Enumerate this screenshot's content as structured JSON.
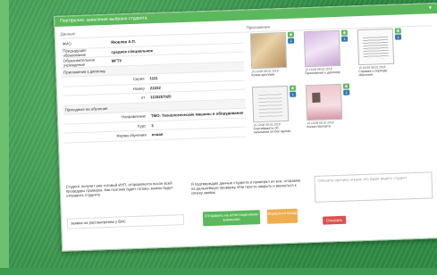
{
  "panel": {
    "title": "Портфолио: заявление выбранн студента"
  },
  "columns": {
    "data_label": "Данные",
    "attachments_label": "Приложения"
  },
  "form": {
    "fio": {
      "label": "ФИО",
      "value": "Яковлев А.П."
    },
    "prev_education": {
      "label": "Предыдущее образование",
      "value": "среднее специальное"
    },
    "institution": {
      "label": "Образовательное учреждение",
      "value": "МГТУ"
    },
    "diploma_section": "Приложения к диплому",
    "series": {
      "label": "Серия",
      "value": "1111"
    },
    "number": {
      "label": "Номер",
      "value": "22222"
    },
    "from": {
      "label": "от",
      "value": "1115257020"
    },
    "study_section": "Пригодные на обучение",
    "direction": {
      "label": "Направление",
      "value": "ТМО: Технологические машины и оборудование"
    },
    "course": {
      "label": "Курс",
      "value": "3"
    },
    "form_of_study": {
      "label": "Форма обучения",
      "value": "очная"
    }
  },
  "attachments": [
    {
      "meta": "15.19:08 08.02.2018",
      "caption": "Копия диплома"
    },
    {
      "meta": "15.19:08 08.02.2018",
      "caption": "Приложение к диплому"
    },
    {
      "meta": "15.19:08 08.02.2018",
      "caption": "Справка о периоде обучения"
    },
    {
      "meta": "15.19:08 08.02.2018",
      "caption": "Сертификаты об окончании on-line курсов"
    },
    {
      "meta": "15.19:08 08.02.2018",
      "caption": "Копия паспорта"
    }
  ],
  "icons": {
    "view": "eye-icon",
    "download": "download-icon"
  },
  "bottom": {
    "note_left": "Студент получит уже готовый ИУП, отправляется после всей процедуры проверок. Как поэтому будет готовы, можно будет отправить студенту",
    "status": "заявка на рассмотрении у ВАС",
    "note_mid": "Я подтверждаю данные студента и проверил их все, отправлю на дальнейшую проверку. Или просто закрыть и вернуться к списку заявок",
    "send_label": "Отправить на аттестационную комиссию",
    "back_label": "Вернуться назад",
    "reason_placeholder": "Опишите причину отказа, это будет видеть студент",
    "reject_label": "Отказать"
  },
  "colors": {
    "green": "#5cb85c",
    "blue": "#337ab7",
    "orange": "#f0ad4e",
    "red": "#d9534f"
  }
}
